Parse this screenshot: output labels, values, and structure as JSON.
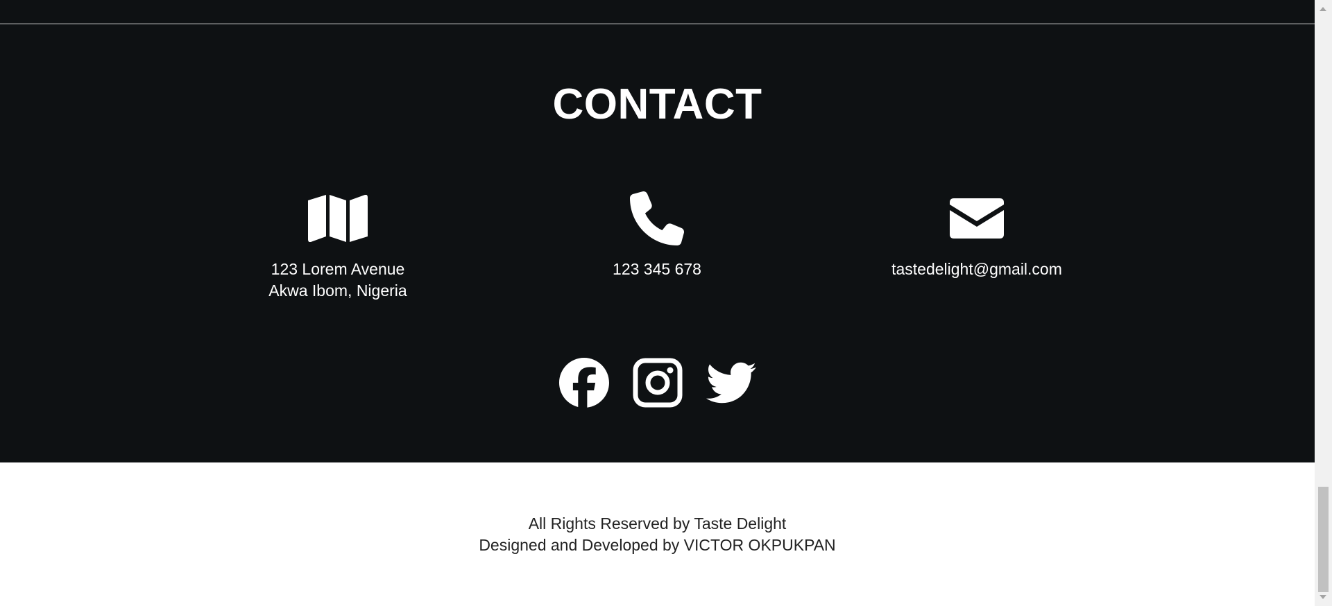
{
  "contact": {
    "title": "CONTACT",
    "address": {
      "icon": "map-icon",
      "line1": "123 Lorem Avenue",
      "line2": "Akwa Ibom, Nigeria"
    },
    "phone": {
      "icon": "phone-icon",
      "number": "123 345 678"
    },
    "email": {
      "icon": "envelope-icon",
      "address": "tastedelight@gmail.com"
    },
    "socials": [
      {
        "name": "facebook",
        "icon": "facebook-icon"
      },
      {
        "name": "instagram",
        "icon": "instagram-icon"
      },
      {
        "name": "twitter",
        "icon": "twitter-icon"
      }
    ]
  },
  "footer": {
    "line1": "All Rights Reserved by Taste Delight",
    "line2": "Designed and Developed by VICTOR OKPUKPAN"
  },
  "colors": {
    "section_bg": "#0e1113",
    "text_light": "#ffffff",
    "footer_bg": "#ffffff",
    "footer_text": "#222222"
  }
}
